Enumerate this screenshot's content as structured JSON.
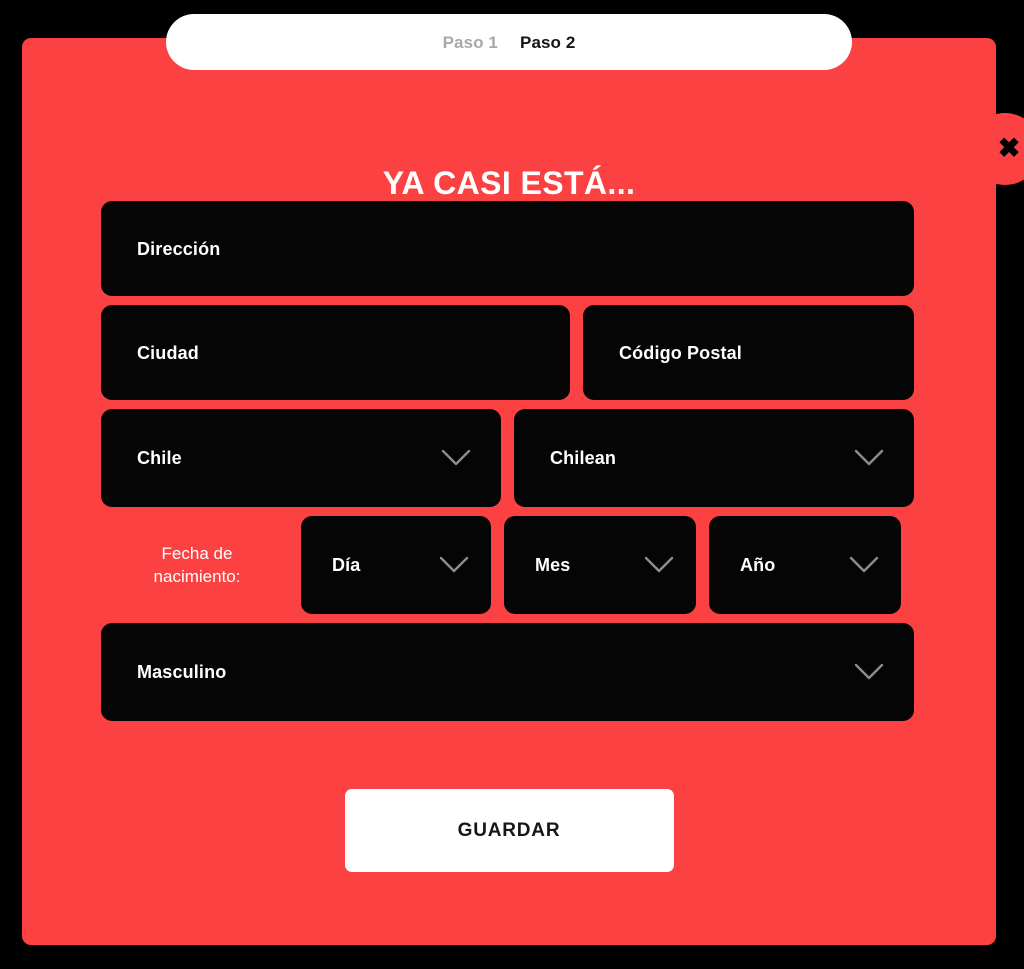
{
  "theme": {
    "accent_red": "#FB4141",
    "field_black": "#050505",
    "page_black": "#000000",
    "white": "#FFFFFF",
    "muted_step": "#A8A8A8"
  },
  "steps": {
    "step1_label": "Paso 1",
    "step2_label": "Paso 2"
  },
  "close": {
    "icon": "close-icon",
    "glyph": "✖"
  },
  "modal": {
    "title": "YA CASI ESTÁ..."
  },
  "form": {
    "address": {
      "value": "Dirección",
      "placeholder": "Dirección"
    },
    "city": {
      "value": "Ciudad",
      "placeholder": "Ciudad"
    },
    "postal_code": {
      "value": "Código Postal",
      "placeholder": "Código Postal"
    },
    "country": {
      "value": "Chile",
      "icon": "chevron-down-icon"
    },
    "nationality": {
      "value": "Chilean",
      "icon": "chevron-down-icon"
    },
    "birth_date": {
      "label_line1": "Fecha de",
      "label_line2": "nacimiento:",
      "day": {
        "value": "Día",
        "icon": "chevron-down-icon"
      },
      "month": {
        "value": "Mes",
        "icon": "chevron-down-icon"
      },
      "year": {
        "value": "Año",
        "icon": "chevron-down-icon"
      }
    },
    "gender": {
      "value": "Masculino",
      "icon": "chevron-down-icon"
    }
  },
  "actions": {
    "save_label": "GUARDAR"
  }
}
